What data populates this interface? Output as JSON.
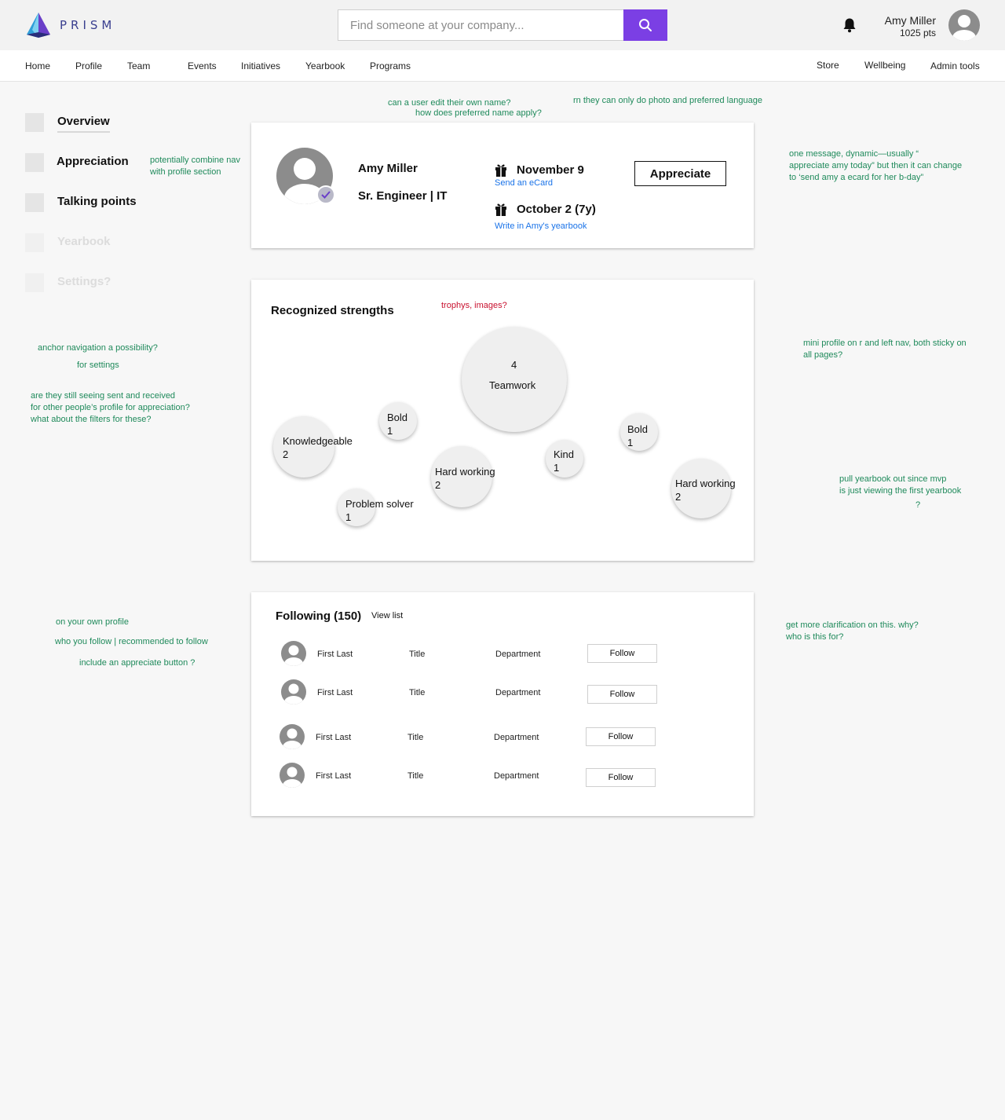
{
  "header": {
    "logo_text": "PRISM",
    "search_placeholder": "Find someone at your company...",
    "user_name": "Amy Miller",
    "user_points": "1025 pts"
  },
  "nav": {
    "left": [
      "Home",
      "Profile",
      "Team",
      "Events",
      "Initiatives",
      "Yearbook",
      "Programs"
    ],
    "right": [
      "Store",
      "Wellbeing",
      "Admin tools"
    ]
  },
  "left_nav": [
    {
      "label": "Overview",
      "state": "active"
    },
    {
      "label": "Appreciation",
      "state": "normal"
    },
    {
      "label": "Talking points",
      "state": "normal"
    },
    {
      "label": "Yearbook",
      "state": "disabled"
    },
    {
      "label": "Settings?",
      "state": "disabled"
    }
  ],
  "profile": {
    "name": "Amy Miller",
    "title": "Sr. Engineer | IT",
    "birthday": "November 9",
    "birthday_link": "Send an eCard",
    "anniversary": "October 2 (7y)",
    "anniversary_link": "Write in Amy's yearbook",
    "appreciate_label": "Appreciate"
  },
  "strengths": {
    "title": "Recognized strengths",
    "items": [
      {
        "name": "Teamwork",
        "count": "4"
      },
      {
        "name": "Knowledgeable",
        "count": "2"
      },
      {
        "name": "Bold",
        "count": "1"
      },
      {
        "name": "Hard working",
        "count": "2"
      },
      {
        "name": "Problem solver",
        "count": "1"
      },
      {
        "name": "Kind",
        "count": "1"
      },
      {
        "name": "Bold",
        "count": "1"
      },
      {
        "name": "Hard working",
        "count": "2"
      }
    ]
  },
  "following": {
    "title": "Following (150)",
    "view_list": "View list",
    "follow_label": "Follow",
    "rows": [
      {
        "name": "First Last",
        "title": "Title",
        "department": "Department"
      },
      {
        "name": "First Last",
        "title": "Title",
        "department": "Department"
      },
      {
        "name": "First Last",
        "title": "Title",
        "department": "Department"
      },
      {
        "name": "First Last",
        "title": "Title",
        "department": "Department"
      }
    ]
  },
  "notes": {
    "edit_name": "can a user edit their own name?",
    "preferred_name": "how does preferred name apply?",
    "photo_language": "rn they can only do photo and preferred language",
    "combine_nav_1": "potentially combine nav",
    "combine_nav_2": "with profile section",
    "one_message_1": "one message, dynamic—usually “",
    "one_message_2": "appreciate amy today” but then it can change",
    "one_message_3": "to ‘send amy a ecard for her b-day”",
    "trophies": "trophys, images?",
    "anchor_nav": "anchor navigation a possibility?",
    "for_settings": "for settings",
    "sent_received_1": "are they still seeing sent and received",
    "sent_received_2": "for other people’s profile for appreciation?",
    "sent_received_3": "what about the filters for these?",
    "mini_profile_1": "mini profile on r and left nav, both sticky on",
    "mini_profile_2": "all pages?",
    "yearbook_1": "pull yearbook out since mvp",
    "yearbook_2": "is just viewing the first yearbook",
    "yearbook_3": "?",
    "own_profile": "on your own profile",
    "who_follow": "who you follow | recommended to follow",
    "appreciate_button": "include an appreciate button ?",
    "clarification_1": "get more clarification on this. why?",
    "clarification_2": "who is this for?"
  },
  "colors": {
    "accent": "#7b3fe4",
    "link": "#1a73e8",
    "note_green": "#1f8a5b",
    "note_red": "#c8102e"
  }
}
